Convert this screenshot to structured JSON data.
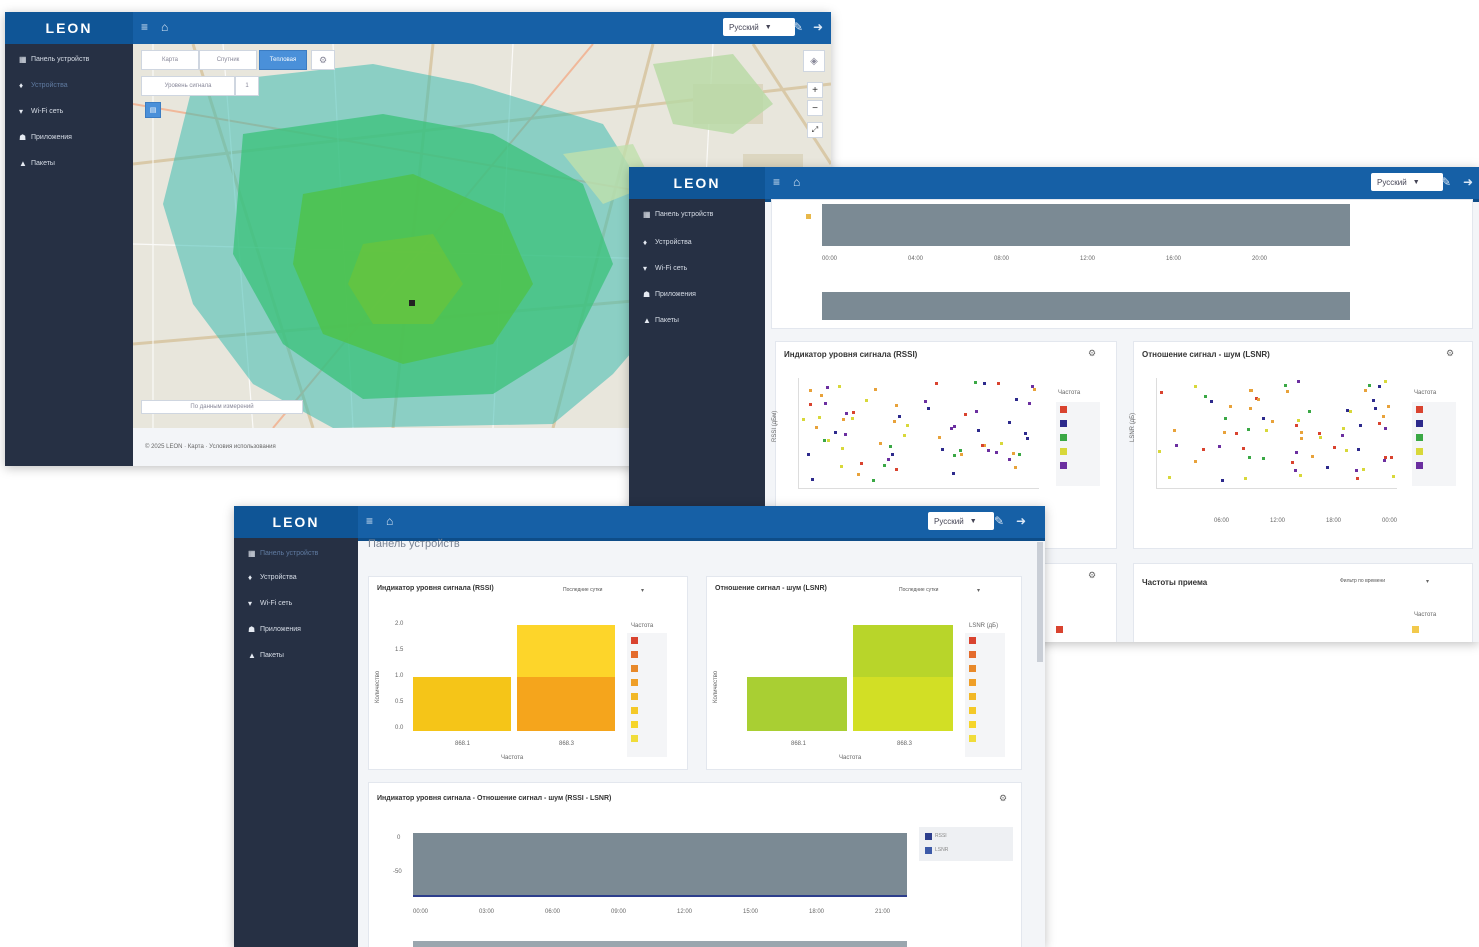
{
  "brand": {
    "logo": "LEON",
    "primary": "#1660a6",
    "sidebar_bg": "#263044"
  },
  "lang_selector": "Русский",
  "nav": [
    {
      "label": "Панель устройств",
      "icon": "dashboard-icon"
    },
    {
      "label": "Устройства",
      "icon": "device-icon"
    },
    {
      "label": "Wi-Fi сеть",
      "icon": "wifi-icon"
    },
    {
      "label": "Приложения",
      "icon": "apps-icon"
    },
    {
      "label": "Пакеты",
      "icon": "upload-icon"
    }
  ],
  "window1": {
    "map_buttons": [
      "Карта",
      "Спутник",
      "Тепловая"
    ],
    "layer_select": "Уровень сигнала",
    "layer_value": "1",
    "map_note": "По данным измерений",
    "footer": "© 2025 LEON · Карта · Условия использования"
  },
  "window2": {
    "scatter_panels": [
      {
        "title": "Индикатор уровня сигнала (RSSI)",
        "ylabel": "RSSI (дБм)",
        "legend_title": "Частота"
      },
      {
        "title": "Отношение сигнал - шум (LSNR)",
        "ylabel": "LSNR (дБ)",
        "legend_title": "Частота"
      }
    ],
    "top_ticks": [
      "00:00",
      "04:00",
      "08:00",
      "12:00",
      "16:00",
      "20:00"
    ],
    "scatter_xticks": [
      "06:00",
      "12:00",
      "18:00",
      "00:00"
    ],
    "bottom_panels": [
      {
        "title": "Частоты приема",
        "legend_title": "Частота"
      }
    ],
    "filter_label": "Фильтр по времени"
  },
  "window3": {
    "page_title": "Панель устройств",
    "bar_panels": [
      {
        "title": "Индикатор уровня сигнала (RSSI)",
        "filter": "Последние сутки",
        "ylabel": "Количество",
        "xlabel": "Частота",
        "legend_title": "Частота",
        "categories": [
          "868.1",
          "868.3"
        ]
      },
      {
        "title": "Отношение сигнал - шум (LSNR)",
        "filter": "Последние сутки",
        "ylabel": "Количество",
        "xlabel": "Частота",
        "legend_title": "LSNR (дБ)",
        "categories": [
          "868.1",
          "868.3"
        ]
      }
    ],
    "bar_yticks": [
      "2.0",
      "1.5",
      "1.0",
      "0.5",
      "0.0"
    ],
    "timeline_panel": {
      "title": "Индикатор уровня сигнала - Отношение сигнал - шум (RSSI - LSNR)",
      "xticks": [
        "00:00",
        "03:00",
        "06:00",
        "09:00",
        "12:00",
        "15:00",
        "18:00",
        "21:00"
      ],
      "yticks": [
        "0",
        "-50"
      ],
      "legend": [
        "RSSI",
        "LSNR"
      ]
    }
  }
}
